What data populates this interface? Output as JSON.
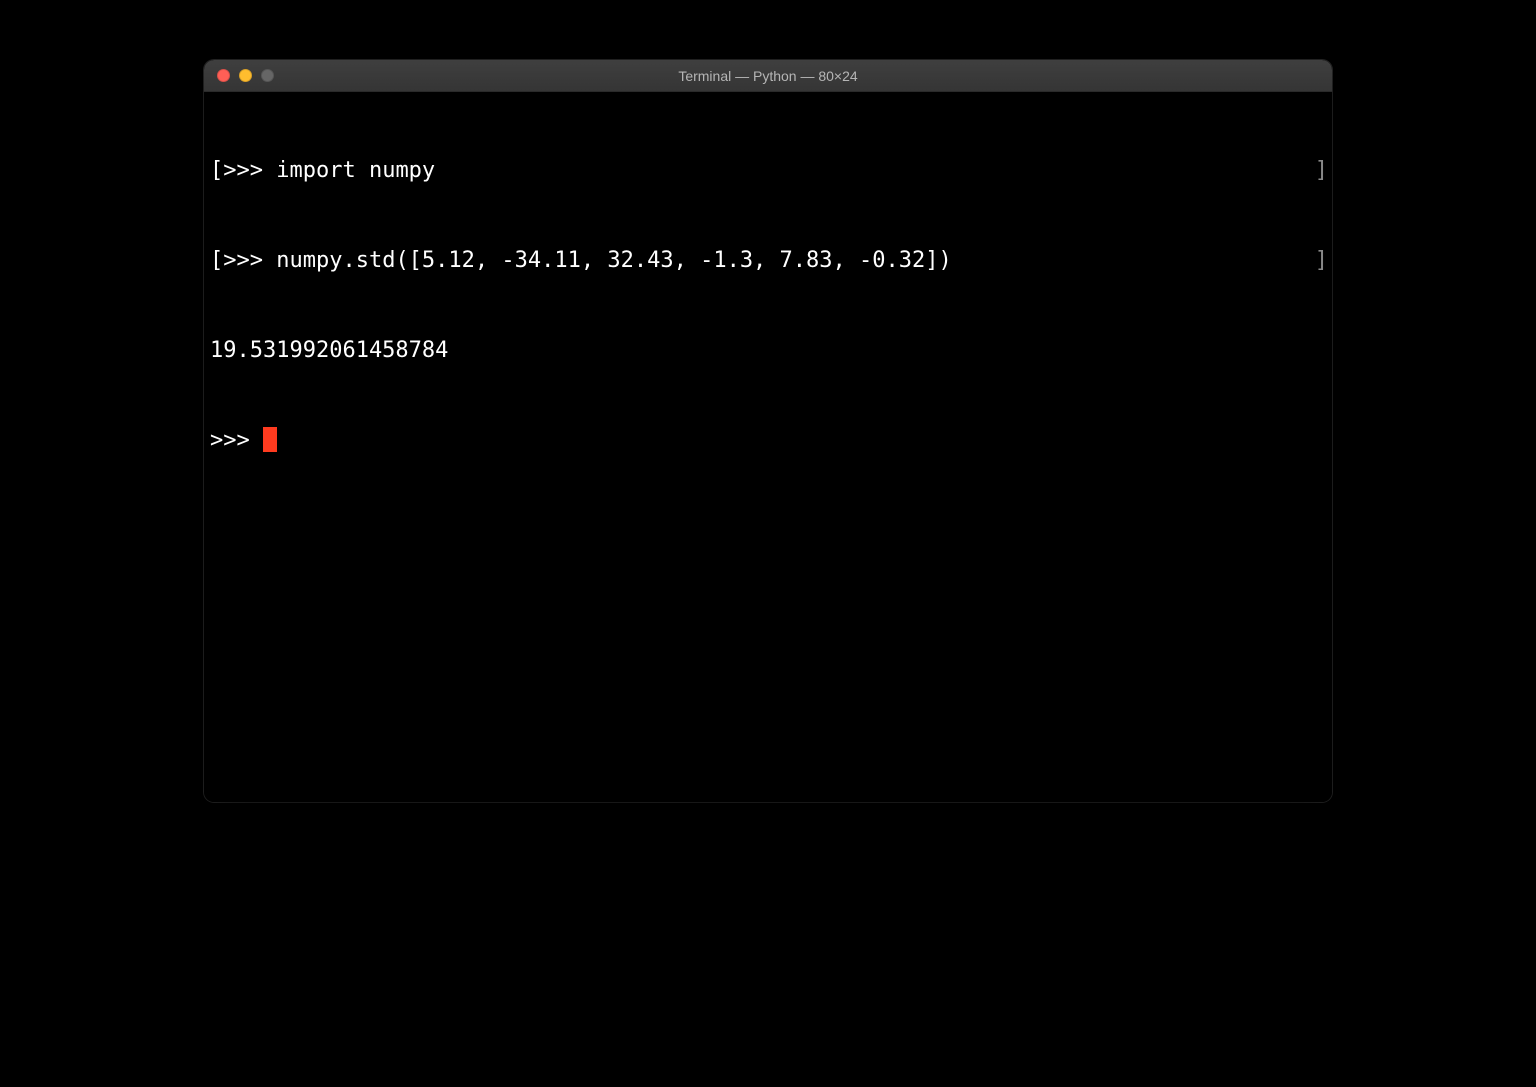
{
  "window": {
    "title": "Terminal — Python — 80×24"
  },
  "terminal": {
    "lines": [
      {
        "prompt": ">>> ",
        "text": "import numpy",
        "rbracket": "]"
      },
      {
        "prompt": ">>> ",
        "text": "numpy.std([5.12, -34.11, 32.43, -1.3, 7.83, -0.32])",
        "rbracket": "]"
      },
      {
        "prompt": "",
        "text": "19.531992061458784",
        "rbracket": ""
      },
      {
        "prompt": ">>> ",
        "text": "",
        "rbracket": "",
        "cursor": true
      }
    ]
  }
}
